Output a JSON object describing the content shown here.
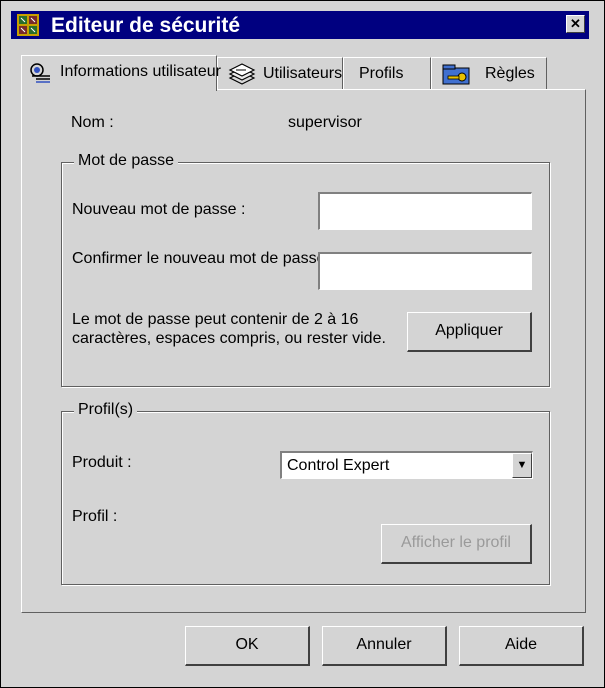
{
  "window": {
    "title": "Editeur de sécurité",
    "close_glyph": "✕",
    "app_icon": "building-grid-icon"
  },
  "tabs": [
    {
      "label": "Informations utilisateur",
      "icon": "user-info-icon",
      "active": true
    },
    {
      "label": "Utilisateurs",
      "icon": "user-stack-icon",
      "active": false
    },
    {
      "label": "Profils",
      "icon": "",
      "active": false
    },
    {
      "label": "Règles",
      "icon": "key-folder-icon",
      "active": false
    }
  ],
  "user": {
    "name_label": "Nom :",
    "name_value": "supervisor"
  },
  "password": {
    "group_title": "Mot de passe",
    "new_label": "Nouveau mot de passe :",
    "new_value": "",
    "confirm_label": "Confirmer le nouveau mot de passe",
    "confirm_value": "",
    "hint_line1": "Le mot de passe peut contenir de 2 à 16",
    "hint_line2": "caractères, espaces compris, ou rester vide.",
    "apply_label": "Appliquer"
  },
  "profiles": {
    "group_title": "Profil(s)",
    "product_label": "Produit :",
    "product_value": "Control Expert",
    "profile_label": "Profil :",
    "show_profile_label": "Afficher le profil"
  },
  "footer": {
    "ok_label": "OK",
    "cancel_label": "Annuler",
    "help_label": "Aide"
  }
}
